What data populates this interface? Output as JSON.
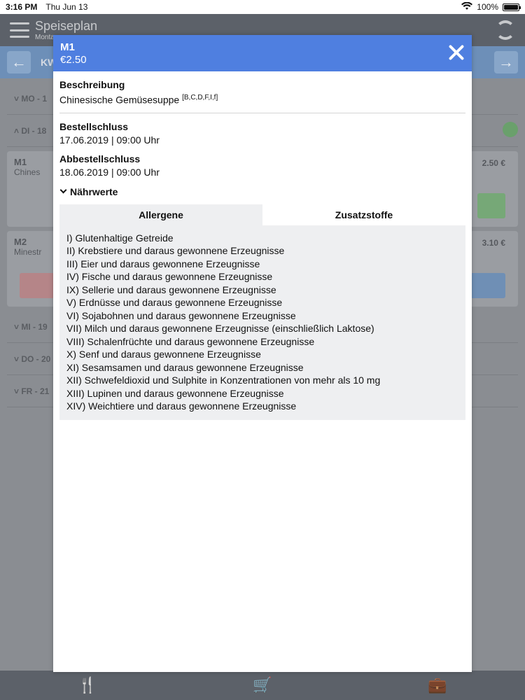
{
  "status_bar": {
    "time": "3:16 PM",
    "date": "Thu Jun 13",
    "battery": "100%"
  },
  "app": {
    "title": "Speiseplan",
    "subtitle": "Montag",
    "week_label": "KW",
    "days": [
      {
        "label": "MO - 1"
      },
      {
        "label": "DI - 18"
      },
      {
        "label": "MI - 19"
      },
      {
        "label": "DO - 20"
      },
      {
        "label": "FR - 21"
      }
    ],
    "meals": [
      {
        "code": "M1",
        "name": "Chines",
        "price": "2.50 €"
      },
      {
        "code": "M2",
        "name": "Minestr",
        "price": "3.10 €"
      }
    ]
  },
  "modal": {
    "code": "M1",
    "price": "€2.50",
    "description_label": "Beschreibung",
    "description": "Chinesische Gemüsesuppe ",
    "allergen_codes": "[B,C,D,F,I,f]",
    "order_deadline_label": "Bestellschluss",
    "order_deadline": "17.06.2019 | 09:00 Uhr",
    "cancel_deadline_label": "Abbestellschluss",
    "cancel_deadline": "18.06.2019 | 09:00 Uhr",
    "nutrition_toggle": "Nährwerte",
    "tabs": [
      {
        "label": "Allergene",
        "active": true
      },
      {
        "label": "Zusatzstoffe",
        "active": false
      }
    ],
    "allergens": [
      "I) Glutenhaltige Getreide",
      "II) Krebstiere und daraus gewonnene Erzeugnisse",
      "III) Eier und daraus gewonnene Erzeugnisse",
      "IV) Fische und daraus gewonnene Erzeugnisse",
      "IX) Sellerie und daraus gewonnene Erzeugnisse",
      "V) Erdnüsse und daraus gewonnene Erzeugnisse",
      "VI) Sojabohnen und daraus gewonnene Erzeugnisse",
      "VII) Milch und daraus gewonnene Erzeugnisse (einschließlich Laktose)",
      "VIII) Schalenfrüchte und daraus gewonnene Erzeugnisse",
      "X) Senf und daraus gewonnene Erzeugnisse",
      "XI) Sesamsamen und daraus gewonnene Erzeugnisse",
      "XII) Schwefeldioxid und Sulphite in Konzentrationen von mehr als 10 mg",
      "XIII) Lupinen und daraus gewonnene Erzeugnisse",
      "XIV) Weichtiere und daraus gewonnene Erzeugnisse"
    ]
  },
  "colors": {
    "modal_header": "#4f7fe0",
    "tab_panel": "#eeeff1"
  }
}
